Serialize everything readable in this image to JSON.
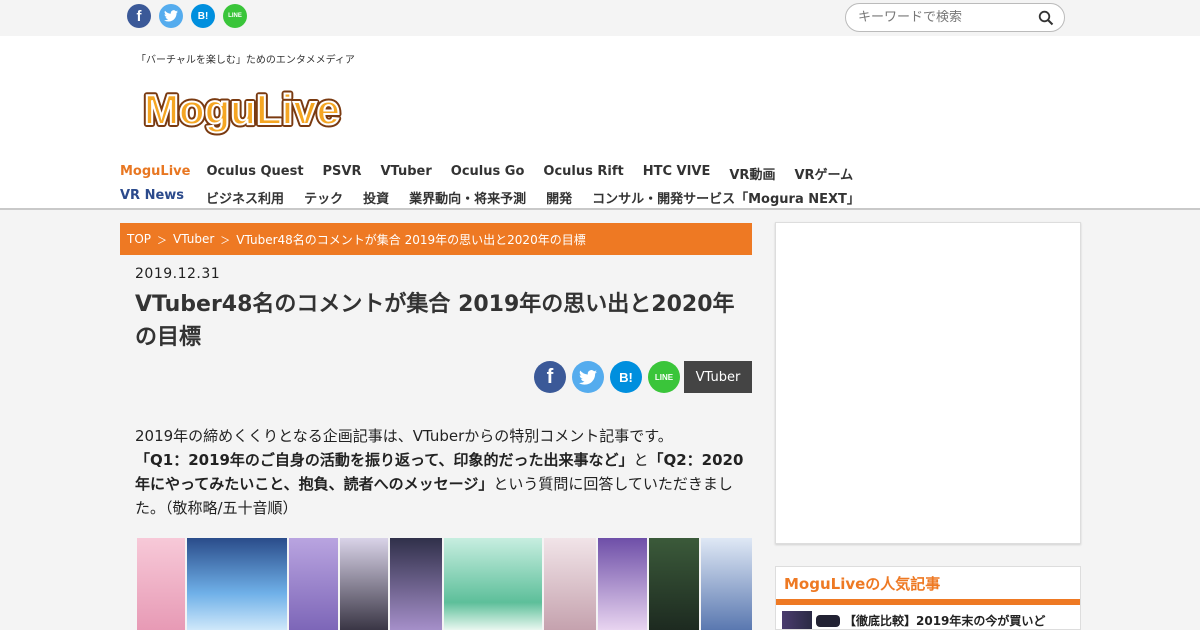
{
  "topbar": {
    "social": [
      {
        "name": "facebook",
        "glyph": "f"
      },
      {
        "name": "twitter",
        "glyph": ""
      },
      {
        "name": "hatena",
        "glyph": "B!"
      },
      {
        "name": "line",
        "glyph": "LINE"
      }
    ],
    "search_placeholder": "キーワードで検索"
  },
  "header": {
    "tagline": "「バーチャルを楽しむ」ためのエンタメメディア",
    "logo_text": "MoguLive"
  },
  "nav": {
    "row1_label": "MoguLive",
    "row1_items": [
      "Oculus Quest",
      "PSVR",
      "VTuber",
      "Oculus Go",
      "Oculus Rift",
      "HTC VIVE",
      "VR動画",
      "VRゲーム"
    ],
    "row2_label": "VR News",
    "row2_items": [
      "ビジネス利用",
      "テック",
      "投資",
      "業界動向・将来予測",
      "開発",
      "コンサル・開発サービス「Mogura NEXT」"
    ]
  },
  "breadcrumb": {
    "items": [
      "TOP",
      "VTuber",
      "VTuber48名のコメントが集合 2019年の思い出と2020年の目標"
    ],
    "separator": "＞"
  },
  "article": {
    "date": "2019.12.31",
    "title": "VTuber48名のコメントが集合 2019年の思い出と2020年の目標",
    "tag": "VTuber",
    "body_line1": "2019年の締めくくりとなる企画記事は、VTuberからの特別コメント記事です。",
    "q1": "「Q1：2019年のご自身の活動を振り返って、印象的だった出来事など」",
    "and": "と",
    "q2": "「Q2：2020年にやってみたいこと、抱負、読者へのメッセージ」",
    "body_line3": "という質問に回答していただきました。（敬称略/五十音順）"
  },
  "sidebar": {
    "popular_title": "MoguLiveの人気記事",
    "popular_item": "【徹底比較】2019年末の今が買いど"
  },
  "colors": {
    "accent": "#ee7923",
    "nav_blue": "#2b4a8c",
    "tag_bg": "#444444"
  }
}
